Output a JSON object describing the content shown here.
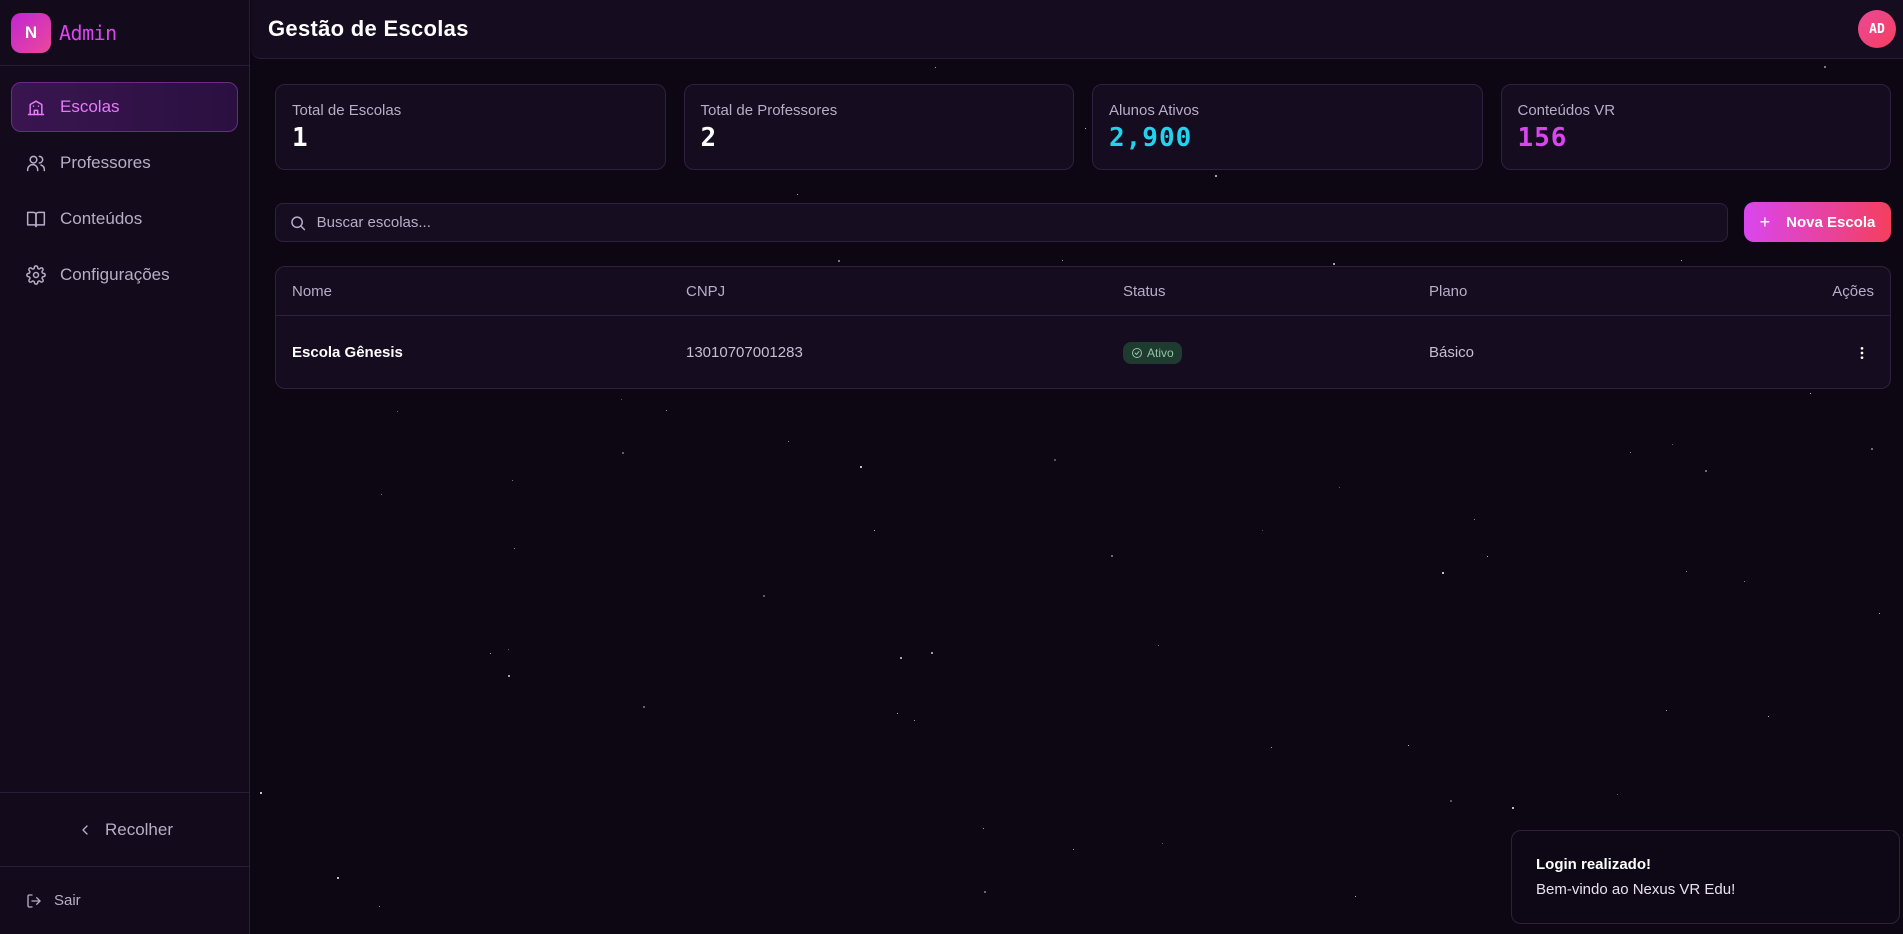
{
  "brand": {
    "logo_letter": "N",
    "name": "Admin"
  },
  "sidebar": {
    "items": [
      {
        "label": "Escolas",
        "icon": "school-icon"
      },
      {
        "label": "Professores",
        "icon": "users-icon"
      },
      {
        "label": "Conteúdos",
        "icon": "book-open-icon"
      },
      {
        "label": "Configurações",
        "icon": "gear-icon"
      }
    ],
    "collapse_label": "Recolher",
    "logout_label": "Sair"
  },
  "header": {
    "title": "Gestão de Escolas",
    "avatar_initials": "AD"
  },
  "stats": [
    {
      "label": "Total de Escolas",
      "value": "1",
      "color": "#ffffff"
    },
    {
      "label": "Total de Professores",
      "value": "2",
      "color": "#ffffff"
    },
    {
      "label": "Alunos Ativos",
      "value": "2,900",
      "color": "#22d3ee"
    },
    {
      "label": "Conteúdos VR",
      "value": "156",
      "color": "#d946ef"
    }
  ],
  "search": {
    "placeholder": "Buscar escolas...",
    "value": ""
  },
  "toolbar": {
    "new_button_label": "Nova Escola"
  },
  "table": {
    "columns": [
      "Nome",
      "CNPJ",
      "Status",
      "Plano",
      "Ações"
    ],
    "rows": [
      {
        "name": "Escola Gênesis",
        "cnpj": "13010707001283",
        "status": "Ativo",
        "plan": "Básico"
      }
    ]
  },
  "toast": {
    "title": "Login realizado!",
    "message": "Bem-vindo ao Nexus VR Edu!"
  },
  "colors": {
    "accent": "#d946ef",
    "accent_end": "#f43f5e",
    "background": "#0d0714",
    "status_active": "#8fc4a5"
  }
}
